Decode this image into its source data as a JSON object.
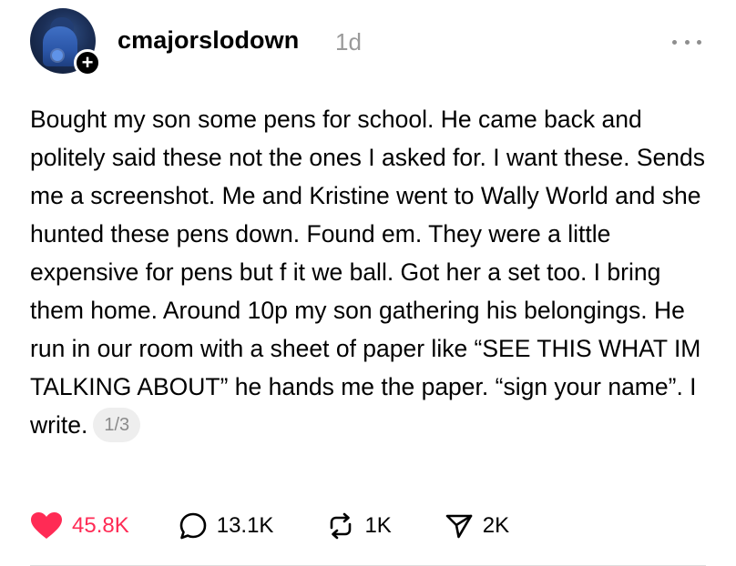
{
  "post": {
    "author": {
      "username": "cmajorslodown",
      "follow_symbol": "+"
    },
    "timestamp": "1d",
    "body": "Bought my son some pens for school. He came back and politely said these not the ones I asked for. I want these. Sends me a screenshot. Me and Kristine went to Wally World and she hunted these pens down. Found em. They were a little expensive for pens but f it we ball. Got her a set too. I bring them home. Around 10p my son gathering his belongings. He run in our room with a sheet of paper like “SEE THIS WHAT IM TALKING ABOUT” he hands me the paper. “sign your name”. I write.",
    "page_indicator": "1/3",
    "stats": {
      "likes": "45.8K",
      "replies": "13.1K",
      "reposts": "1K",
      "shares": "2K"
    },
    "icons": {
      "like": "heart-filled-icon",
      "reply": "comment-bubble-icon",
      "repost": "repost-arrows-icon",
      "share": "send-icon",
      "more": "more-dots-icon"
    },
    "colors": {
      "like_red": "#ff2b55",
      "timestamp_gray": "#9a9a9a",
      "pill_bg": "#eeeeee"
    }
  }
}
